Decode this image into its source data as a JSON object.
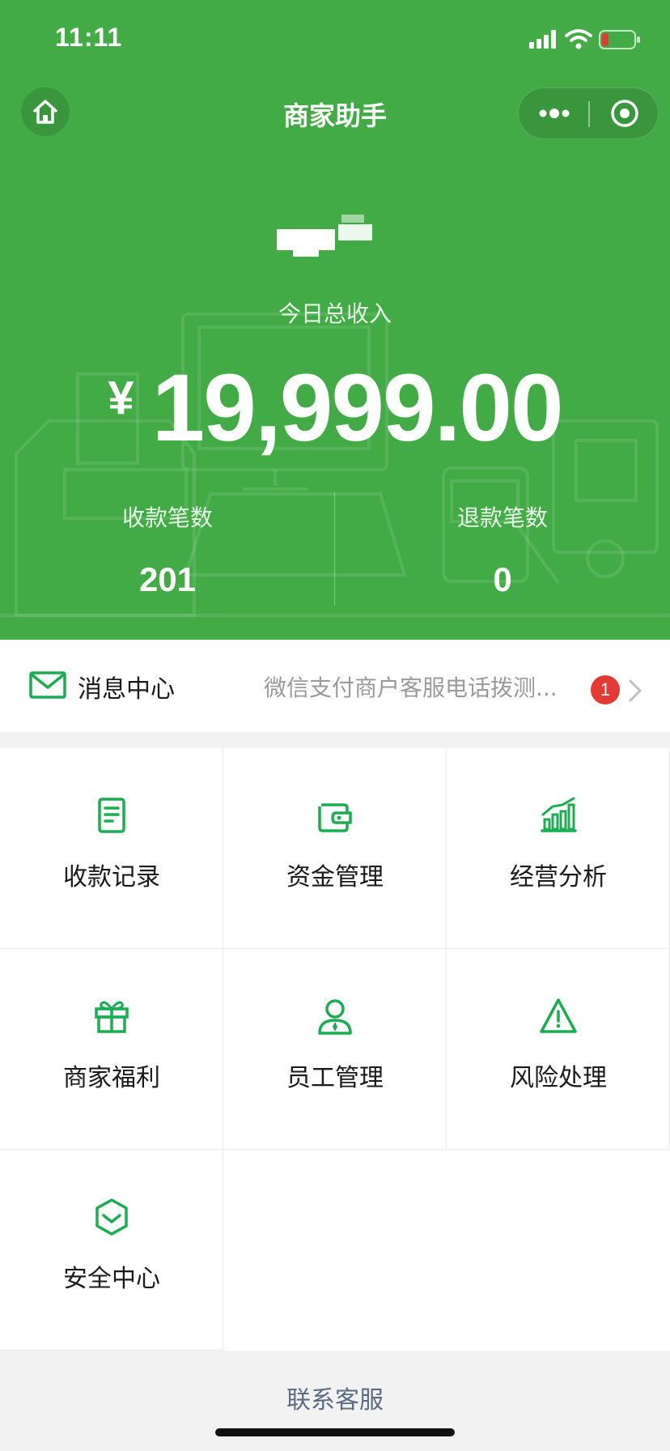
{
  "status_bar": {
    "time": "11:11"
  },
  "nav": {
    "title": "商家助手"
  },
  "summary": {
    "income_label": "今日总收入",
    "currency": "¥",
    "amount": "19,999.00",
    "stats": [
      {
        "label": "收款笔数",
        "value": "201"
      },
      {
        "label": "退款笔数",
        "value": "0"
      }
    ]
  },
  "message_center": {
    "title": "消息中心",
    "preview": "微信支付商户客服电话拨测...",
    "badge": "1"
  },
  "grid": {
    "items": [
      {
        "label": "收款记录",
        "icon": "receipt-icon"
      },
      {
        "label": "资金管理",
        "icon": "wallet-icon"
      },
      {
        "label": "经营分析",
        "icon": "bar-chart-icon"
      },
      {
        "label": "商家福利",
        "icon": "gift-icon"
      },
      {
        "label": "员工管理",
        "icon": "staff-icon"
      },
      {
        "label": "风险处理",
        "icon": "warning-icon"
      },
      {
        "label": "安全中心",
        "icon": "shield-icon"
      }
    ]
  },
  "footer": {
    "link": "联系客服"
  },
  "colors": {
    "brand_green": "#42ab46",
    "icon_green": "#1aad52",
    "badge_red": "#e53935"
  }
}
